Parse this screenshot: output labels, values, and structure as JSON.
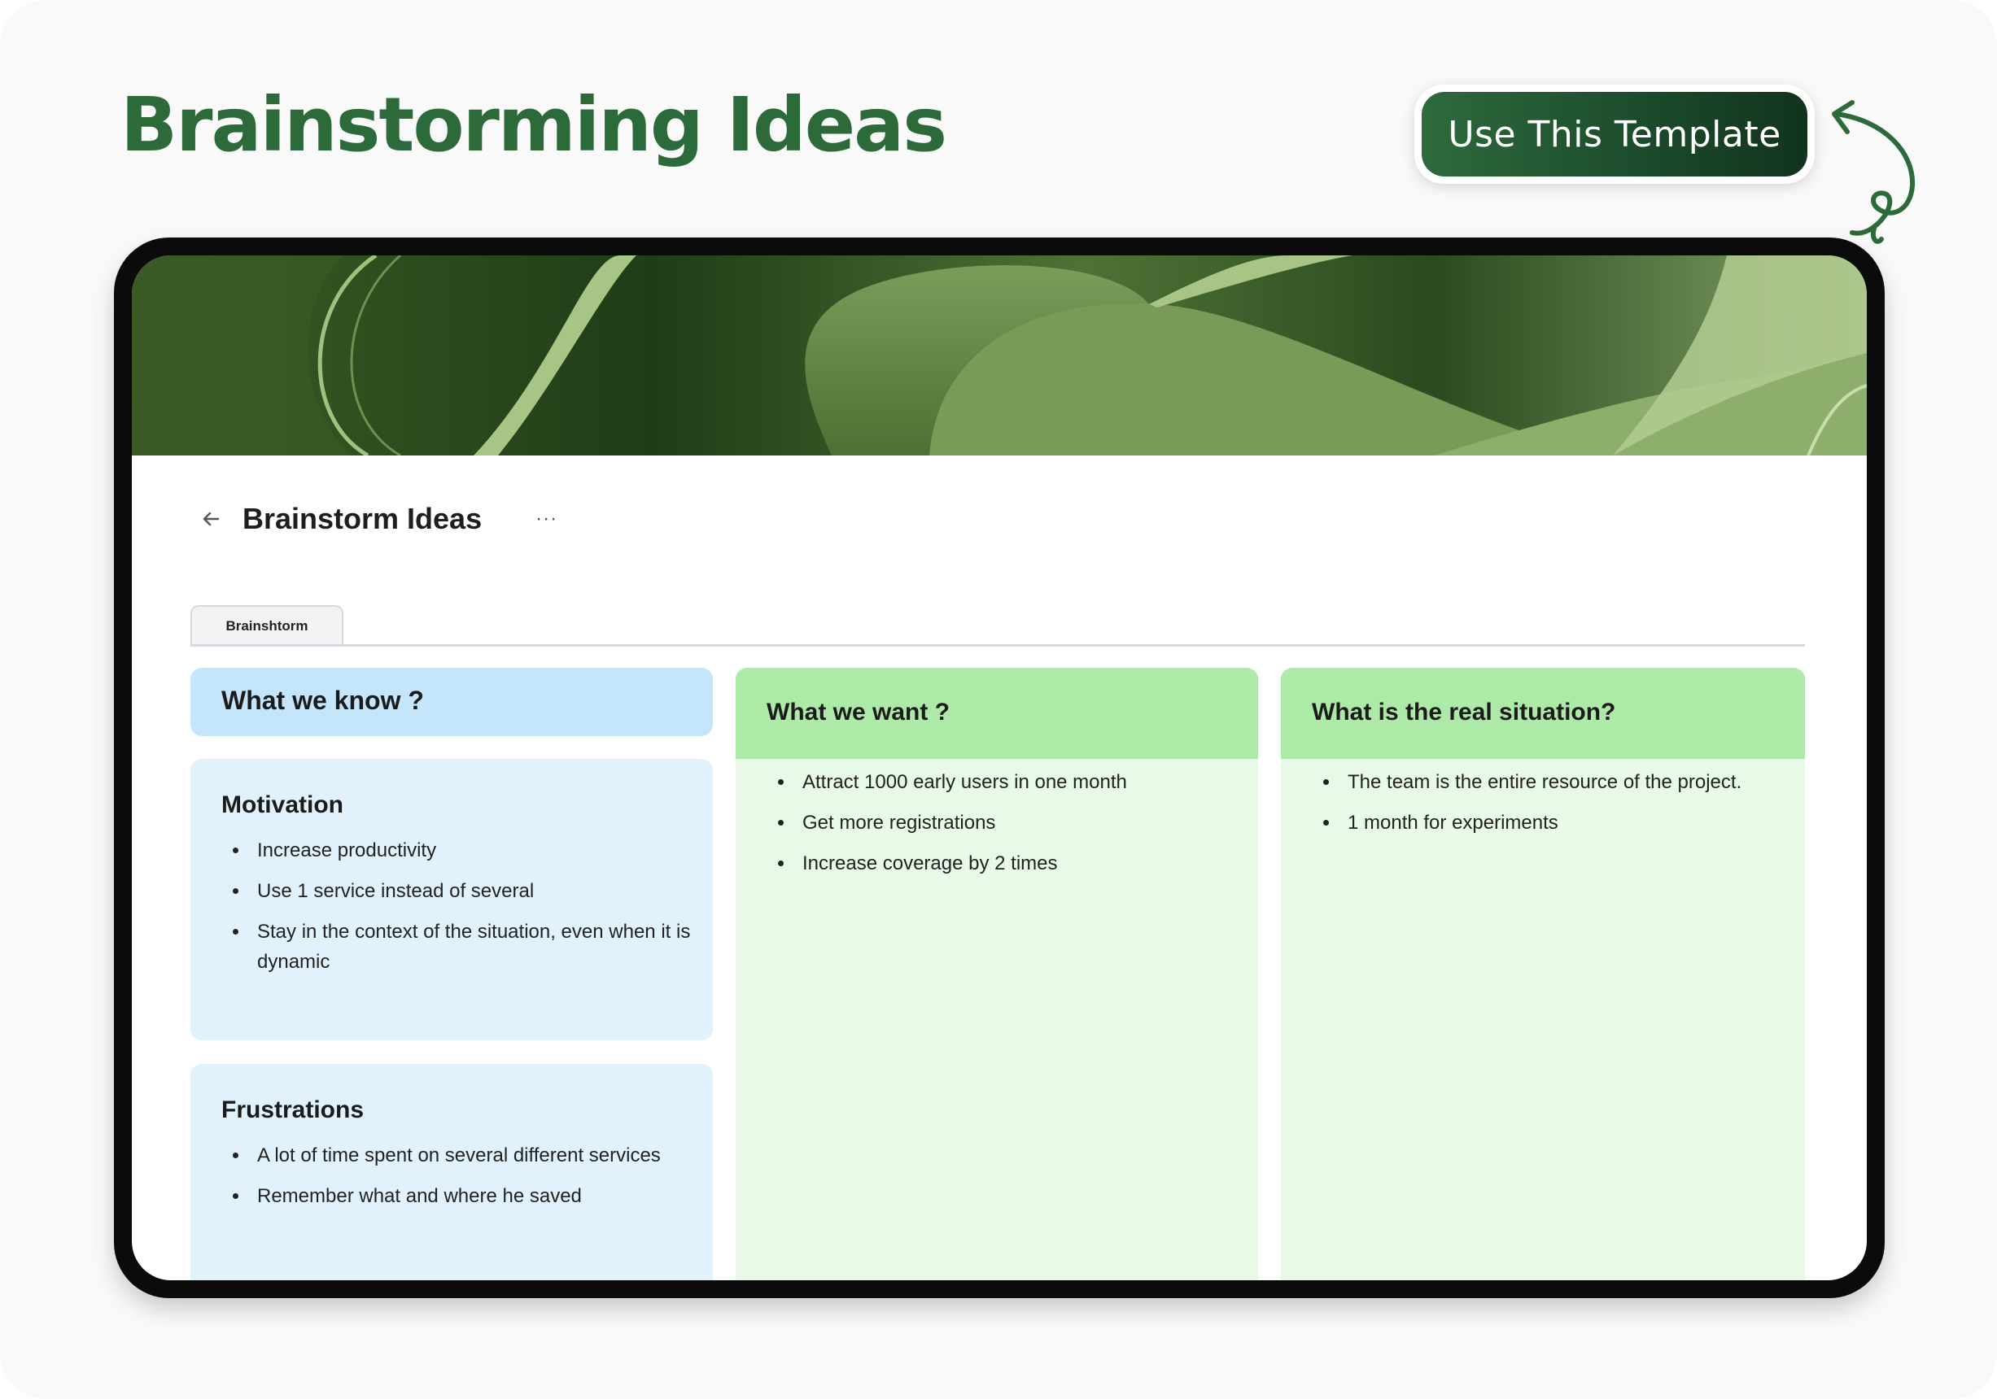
{
  "header": {
    "title": "Brainstorming Ideas",
    "cta_label": "Use This Template"
  },
  "page": {
    "title": "Brainstorm Ideas",
    "more": "···",
    "tab": "Brainshtorm"
  },
  "colors": {
    "brand_green": "#2d6a3a",
    "know_header": "#c5e6fa",
    "know_card": "#e1f2fc",
    "want_header": "#aeeaa7",
    "want_body": "#e9f9e7"
  },
  "columns": {
    "know": {
      "title": "What we know ?",
      "cards": [
        {
          "title": "Motivation",
          "items": [
            "Increase productivity",
            "Use 1 service instead of several",
            "Stay in the context of the situation, even when it is dynamic"
          ]
        },
        {
          "title": "Frustrations",
          "items": [
            "A lot of time spent on several different services",
            "Remember what and where he saved"
          ]
        }
      ]
    },
    "want": {
      "title": "What we want ?",
      "items": [
        "Attract 1000 early users in one month",
        "Get more registrations",
        "Increase coverage by 2 times"
      ]
    },
    "situation": {
      "title": "What is the real situation?",
      "items": [
        "The team is the entire resource of the project.",
        "1 month for experiments"
      ]
    }
  }
}
